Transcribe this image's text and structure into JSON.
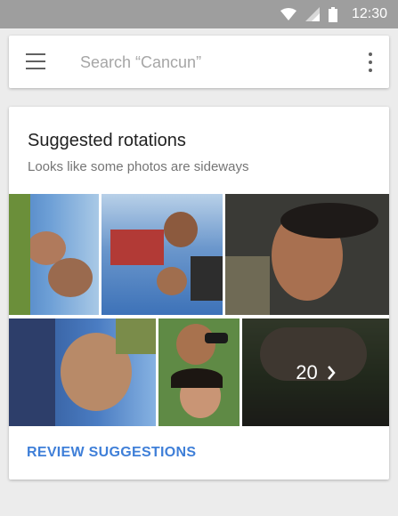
{
  "status_bar": {
    "time": "12:30"
  },
  "search": {
    "placeholder": "Search “Cancun”"
  },
  "icons": [
    "wifi-icon",
    "signal-icon",
    "battery-icon",
    "menu-icon",
    "more-vert-icon",
    "chevron-right-icon"
  ],
  "card": {
    "title": "Suggested rotations",
    "subtitle": "Looks like some photos are sideways",
    "photos_count": "20",
    "review_label": "REVIEW SUGGESTIONS"
  },
  "colors": {
    "accent": "#3f7fd8",
    "status_bar": "#9e9e9e",
    "background": "#ececec"
  }
}
